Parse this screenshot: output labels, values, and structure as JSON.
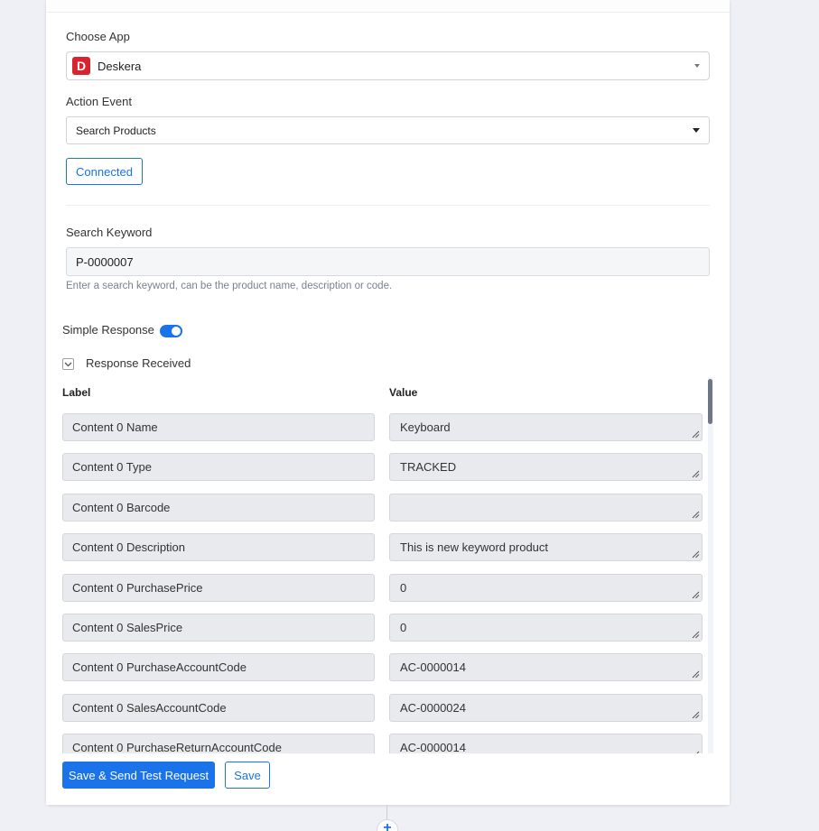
{
  "choose_app": {
    "label": "Choose App",
    "logo_letter": "D",
    "value": "Deskera"
  },
  "action_event": {
    "label": "Action Event",
    "value": "Search Products"
  },
  "connected_label": "Connected",
  "search_keyword": {
    "label": "Search Keyword",
    "value": "P-0000007",
    "help": "Enter a search keyword, can be the product name, description or code."
  },
  "simple_response": {
    "label": "Simple Response",
    "enabled": true
  },
  "response_received": {
    "label": "Response Received",
    "expanded": true
  },
  "table": {
    "label_header": "Label",
    "value_header": "Value",
    "rows": [
      {
        "label": "Content 0 Name",
        "value": "Keyboard"
      },
      {
        "label": "Content 0 Type",
        "value": "TRACKED"
      },
      {
        "label": "Content 0 Barcode",
        "value": ""
      },
      {
        "label": "Content 0 Description",
        "value": "This is new keyword product"
      },
      {
        "label": "Content 0 PurchasePrice",
        "value": "0"
      },
      {
        "label": "Content 0 SalesPrice",
        "value": "0"
      },
      {
        "label": "Content 0 PurchaseAccountCode",
        "value": "AC-0000014"
      },
      {
        "label": "Content 0 SalesAccountCode",
        "value": "AC-0000024"
      },
      {
        "label": "Content 0 PurchaseReturnAccountCode",
        "value": "AC-0000014"
      }
    ]
  },
  "buttons": {
    "save_and_test": "Save & Send Test Request",
    "save": "Save"
  },
  "add_step_symbol": "+",
  "colors": {
    "accent": "#1a73e8",
    "app_logo": "#d9232e"
  }
}
